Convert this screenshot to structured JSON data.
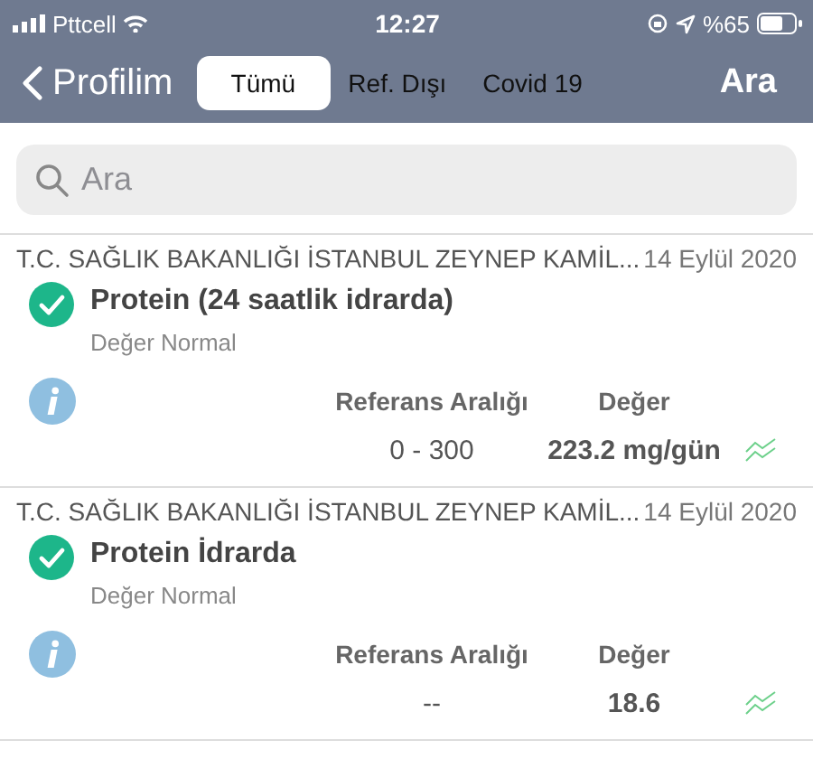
{
  "status_bar": {
    "carrier": "Pttcell",
    "time": "12:27",
    "battery": "%65"
  },
  "nav": {
    "back": "Profilim",
    "action": "Ara",
    "tabs": [
      {
        "label": "Tümü",
        "selected": true
      },
      {
        "label": "Ref. Dışı",
        "selected": false
      },
      {
        "label": "Covid 19",
        "selected": false
      }
    ]
  },
  "search": {
    "placeholder": "Ara"
  },
  "results": [
    {
      "source": "T.C. SAĞLIK BAKANLIĞI İSTANBUL ZEYNEP KAMİL...",
      "date": "14 Eylül 2020",
      "title": "Protein (24 saatlik idrarda)",
      "status": "Değer Normal",
      "normal": true,
      "range_label": "Referans Aralığı",
      "value_label": "Değer",
      "range": "0 - 300",
      "value": "223.2 mg/gün"
    },
    {
      "source": "T.C. SAĞLIK BAKANLIĞI İSTANBUL ZEYNEP KAMİL...",
      "date": "14 Eylül 2020",
      "title": "Protein İdrarda",
      "status": "Değer Normal",
      "normal": true,
      "range_label": "Referans Aralığı",
      "value_label": "Değer",
      "range": "--",
      "value": "18.6"
    }
  ]
}
